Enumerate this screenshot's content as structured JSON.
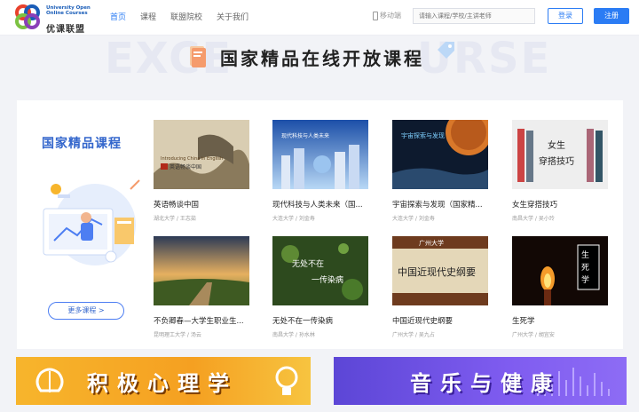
{
  "header": {
    "logo_en": "University Open Online Courses",
    "logo_cn": "优课联盟",
    "nav": [
      {
        "label": "首页",
        "active": true
      },
      {
        "label": "课程",
        "active": false
      },
      {
        "label": "联盟院校",
        "active": false
      },
      {
        "label": "关于我们",
        "active": false
      }
    ],
    "mobile_label": "移动端",
    "search_placeholder": "请输入课程/学校/主讲老师",
    "login_label": "登录",
    "register_label": "注册"
  },
  "hero": {
    "bg_left": "EXCE",
    "bg_right": "URSE",
    "title": "国家精品在线开放课程"
  },
  "panel": {
    "title": "国家精品课程",
    "more_label": "更多课程 >",
    "courses": [
      {
        "name": "英语畅谈中国",
        "school": "湖北大学",
        "teacher": "王志茹",
        "thumb_text": "Introducing China in English 英语畅谈中国"
      },
      {
        "name": "现代科技与人类未来（国...",
        "school": "大连大学",
        "teacher": "刘金寿",
        "thumb_text": "现代科技与人类未来"
      },
      {
        "name": "宇宙探索与发现（国家精...",
        "school": "大连大学",
        "teacher": "刘金寿",
        "thumb_text": "宇宙探索与发现"
      },
      {
        "name": "女生穿搭技巧",
        "school": "南昌大学",
        "teacher": "吴小玲",
        "thumb_text": "女生 穿搭技巧"
      },
      {
        "name": "不负卿春—大学生职业生...",
        "school": "昆明理工大学",
        "teacher": "汤云",
        "thumb_text": ""
      },
      {
        "name": "无处不在一传染病",
        "school": "南昌大学",
        "teacher": "孙水林",
        "thumb_text": "无处不在 一传染病"
      },
      {
        "name": "中国近现代史纲要",
        "school": "广州大学",
        "teacher": "吴九占",
        "thumb_text": "中国近现代史纲要"
      },
      {
        "name": "生死学",
        "school": "广州大学",
        "teacher": "胡宜安",
        "thumb_text": "生 死 学"
      }
    ]
  },
  "banners": [
    {
      "text": "积极心理学"
    },
    {
      "text": "音乐与健康"
    }
  ],
  "colors": {
    "accent": "#2b7cf4",
    "panel_title": "#3366cc",
    "banner_orange": "#f5a021",
    "banner_purple": "#6a4fe0"
  }
}
